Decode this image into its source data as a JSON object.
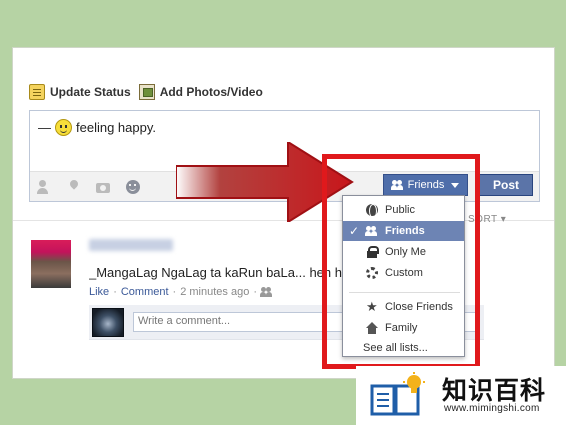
{
  "composer": {
    "tabs": [
      {
        "label": "Update Status",
        "icon": "status-note-icon"
      },
      {
        "label": "Add Photos/Video",
        "icon": "photo-icon"
      }
    ],
    "status_prefix": "—",
    "status_text": "feeling happy.",
    "footer_icons": [
      "tag-friends-icon",
      "location-icon",
      "camera-icon",
      "emoticon-icon"
    ],
    "audience_button": "Friends",
    "post_button": "Post"
  },
  "audience_menu": {
    "items": [
      {
        "label": "Public",
        "icon": "globe-icon",
        "selected": false
      },
      {
        "label": "Friends",
        "icon": "people-icon",
        "selected": true
      },
      {
        "label": "Only Me",
        "icon": "lock-icon",
        "selected": false
      },
      {
        "label": "Custom",
        "icon": "gear-icon",
        "selected": false
      },
      {
        "label": "Close Friends",
        "icon": "star-icon",
        "selected": false
      },
      {
        "label": "Family",
        "icon": "house-icon",
        "selected": false
      }
    ],
    "see_all": "See all lists...",
    "checkmark": "✓"
  },
  "feed": {
    "sort_label": "SORT ▾",
    "post": {
      "text": "_MangaLag NgaLag ta kaRun baLa... heh heh",
      "actions": {
        "like": "Like",
        "comment": "Comment",
        "separator": "·"
      },
      "time": "2 minutes ago",
      "comment_placeholder": "Write a comment..."
    }
  },
  "watermark": {
    "title": "知识百科",
    "url": "www.mimingshi.com"
  },
  "colors": {
    "background": "#b6d3a4",
    "button_blue": "#4f6eaa",
    "highlight_red": "#e0191c",
    "arrow_red": "#c8161b",
    "selected_row": "#6d84b4"
  }
}
